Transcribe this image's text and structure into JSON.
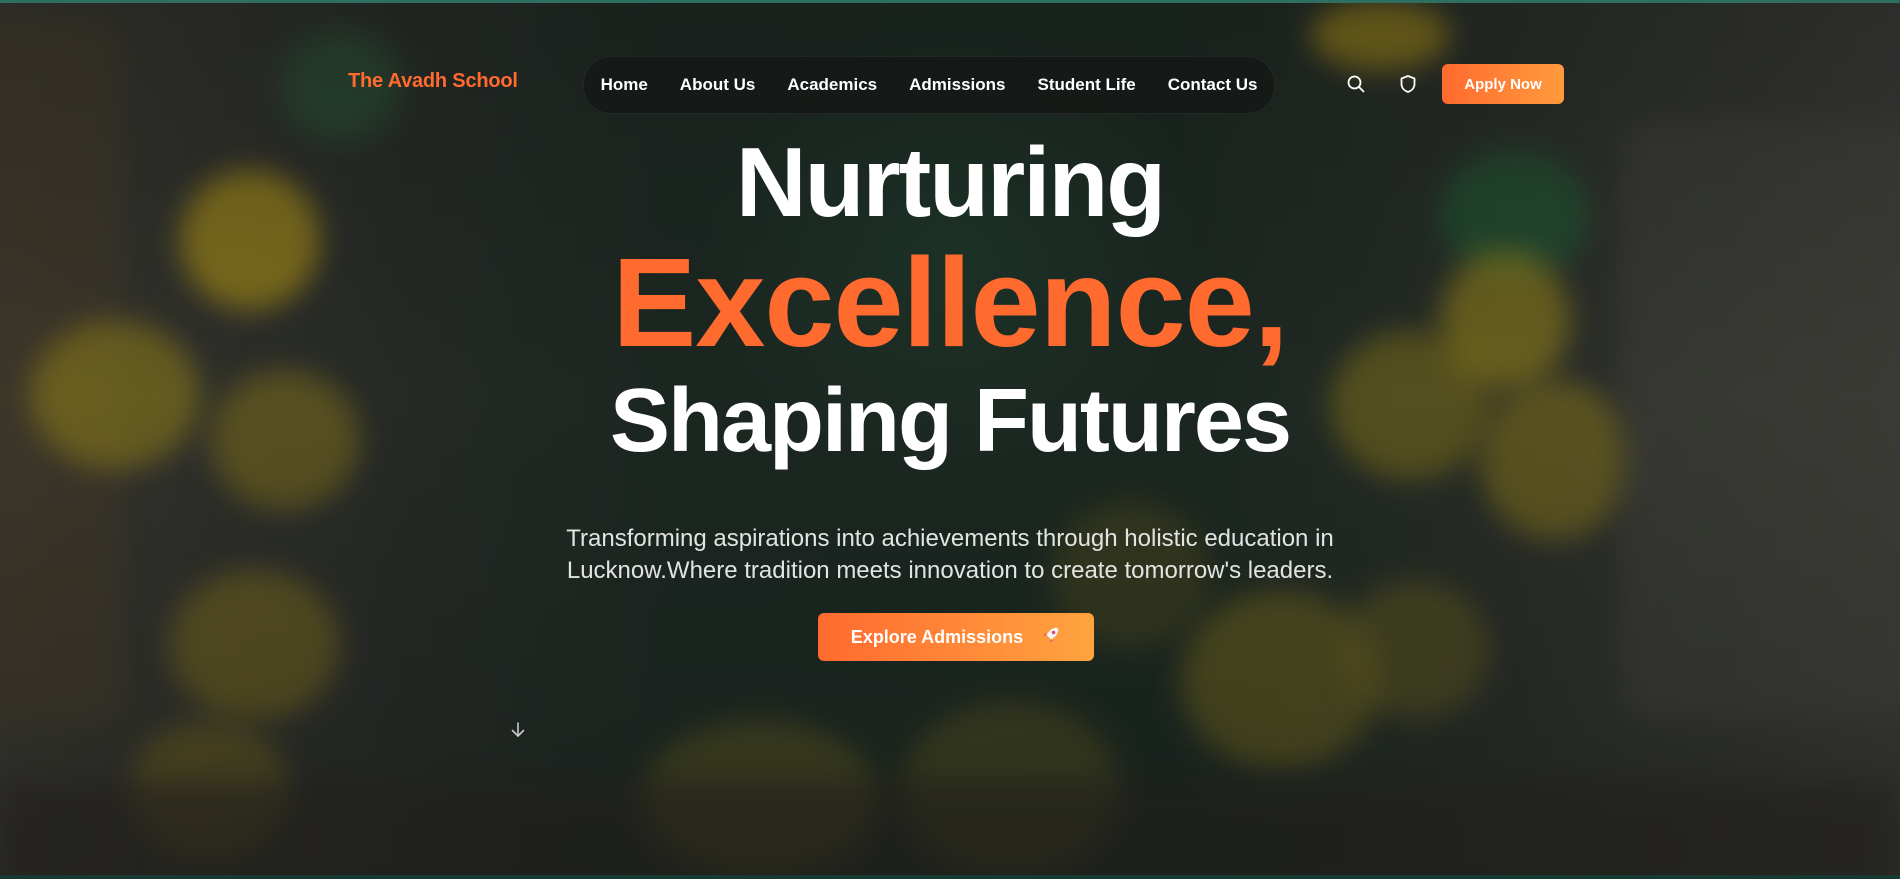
{
  "header": {
    "logo": "The Avadh School",
    "nav": [
      "Home",
      "About Us",
      "Academics",
      "Admissions",
      "Student Life",
      "Contact Us"
    ],
    "search_icon": "search-icon",
    "shield_icon": "shield-icon",
    "apply_label": "Apply Now"
  },
  "hero": {
    "line1": "Nurturing",
    "line2": "Excellence,",
    "line3": "Shaping Futures",
    "subtitle": "Transforming aspirations into achievements through holistic education in Lucknow.Where tradition meets innovation to create tomorrow's leaders.",
    "cta_label": "Explore Admissions",
    "cta_icon": "rocket-icon",
    "scroll_icon": "arrow-down-icon"
  },
  "colors": {
    "accent": "#ff6a2f",
    "accent_end": "#ffa43f",
    "text": "#ffffff",
    "top_line": "#2f6f62"
  }
}
